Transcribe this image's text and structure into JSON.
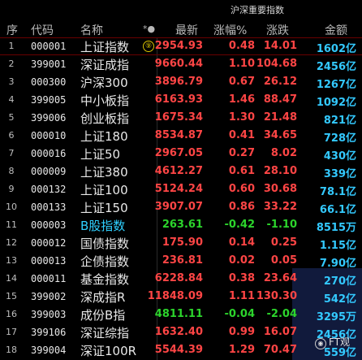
{
  "tab_title": "沪深重要指数",
  "header": {
    "idx": "序",
    "code": "代码",
    "name": "名称",
    "flag": "*●",
    "price": "最新",
    "pct": "涨幅%",
    "chg": "涨跌",
    "amt": "金额"
  },
  "rows": [
    {
      "idx": "1",
      "code": "000001",
      "name": "上证指数",
      "flag": "⑨",
      "price": "2954.93",
      "pct": "0.48",
      "chg": "14.01",
      "amt": "1602亿",
      "dir": "up"
    },
    {
      "idx": "2",
      "code": "399001",
      "name": "深证成指",
      "price": "9660.44",
      "pct": "1.10",
      "chg": "104.68",
      "amt": "2456亿",
      "dir": "up"
    },
    {
      "idx": "3",
      "code": "000300",
      "name": "沪深300",
      "price": "3896.79",
      "pct": "0.67",
      "chg": "26.12",
      "amt": "1267亿",
      "dir": "up"
    },
    {
      "idx": "4",
      "code": "399005",
      "name": "中小板指",
      "price": "6163.93",
      "pct": "1.46",
      "chg": "88.47",
      "amt": "1092亿",
      "dir": "up"
    },
    {
      "idx": "5",
      "code": "399006",
      "name": "创业板指",
      "price": "1675.34",
      "pct": "1.30",
      "chg": "21.48",
      "amt": "821亿",
      "dir": "up"
    },
    {
      "idx": "6",
      "code": "000010",
      "name": "上证180",
      "price": "8534.87",
      "pct": "0.41",
      "chg": "34.65",
      "amt": "728亿",
      "dir": "up"
    },
    {
      "idx": "7",
      "code": "000016",
      "name": "上证50",
      "price": "2967.05",
      "pct": "0.27",
      "chg": "8.02",
      "amt": "430亿",
      "dir": "up"
    },
    {
      "idx": "8",
      "code": "000009",
      "name": "上证380",
      "price": "4612.27",
      "pct": "0.61",
      "chg": "28.10",
      "amt": "339亿",
      "dir": "up"
    },
    {
      "idx": "9",
      "code": "000132",
      "name": "上证100",
      "price": "5124.24",
      "pct": "0.60",
      "chg": "30.68",
      "amt": "78.1亿",
      "dir": "up"
    },
    {
      "idx": "10",
      "code": "000133",
      "name": "上证150",
      "price": "3907.07",
      "pct": "0.86",
      "chg": "33.22",
      "amt": "66.1亿",
      "dir": "up"
    },
    {
      "idx": "11",
      "code": "000003",
      "name": "B股指数",
      "price": "263.61",
      "pct": "-0.42",
      "chg": "-1.10",
      "amt": "8515万",
      "dir": "down",
      "cyan": true
    },
    {
      "idx": "12",
      "code": "000012",
      "name": "国债指数",
      "price": "175.90",
      "pct": "0.14",
      "chg": "0.25",
      "amt": "1.15亿",
      "dir": "up"
    },
    {
      "idx": "13",
      "code": "000013",
      "name": "企债指数",
      "price": "236.81",
      "pct": "0.02",
      "chg": "0.05",
      "amt": "7.90亿",
      "dir": "up"
    },
    {
      "idx": "14",
      "code": "000011",
      "name": "基金指数",
      "price": "6228.84",
      "pct": "0.38",
      "chg": "23.64",
      "amt": "270亿",
      "dir": "up"
    },
    {
      "idx": "15",
      "code": "399002",
      "name": "深成指R",
      "price": "11848.09",
      "pct": "1.11",
      "chg": "130.30",
      "amt": "542亿",
      "dir": "up"
    },
    {
      "idx": "16",
      "code": "399003",
      "name": "成份B指",
      "price": "4811.11",
      "pct": "-0.04",
      "chg": "-2.04",
      "amt": "3295万",
      "dir": "down"
    },
    {
      "idx": "17",
      "code": "399106",
      "name": "深证综指",
      "price": "1632.40",
      "pct": "0.99",
      "chg": "16.07",
      "amt": "2456亿",
      "dir": "up"
    },
    {
      "idx": "18",
      "code": "399004",
      "name": "深证100R",
      "price": "5544.39",
      "pct": "1.29",
      "chg": "70.47",
      "amt": "559亿",
      "dir": "up"
    }
  ],
  "watermark": "FT观"
}
